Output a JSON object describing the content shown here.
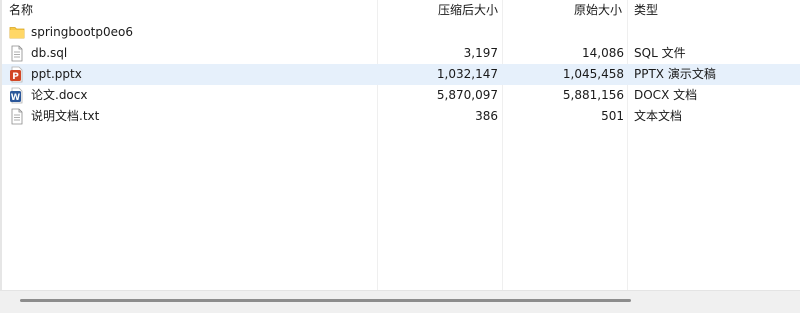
{
  "columns": {
    "name": "名称",
    "compressed_size": "压缩后大小",
    "original_size": "原始大小",
    "type": "类型"
  },
  "sort_indicator": "^",
  "files": [
    {
      "name": "springbootp0eo6",
      "compressed_size": "",
      "original_size": "",
      "type": "",
      "icon": "folder-icon"
    },
    {
      "name": "db.sql",
      "compressed_size": "3,197",
      "original_size": "14,086",
      "type": "SQL 文件",
      "icon": "text-file-icon"
    },
    {
      "name": "ppt.pptx",
      "compressed_size": "1,032,147",
      "original_size": "1,045,458",
      "type": "PPTX 演示文稿",
      "icon": "powerpoint-icon",
      "selected": true
    },
    {
      "name": "论文.docx",
      "compressed_size": "5,870,097",
      "original_size": "5,881,156",
      "type": "DOCX 文档",
      "icon": "word-icon"
    },
    {
      "name": "说明文档.txt",
      "compressed_size": "386",
      "original_size": "501",
      "type": "文本文档",
      "icon": "text-file-icon"
    }
  ],
  "colors": {
    "selection": "#e6f0fb",
    "folder": "#f7c948",
    "powerpoint": "#d24726",
    "word": "#2b579a"
  }
}
